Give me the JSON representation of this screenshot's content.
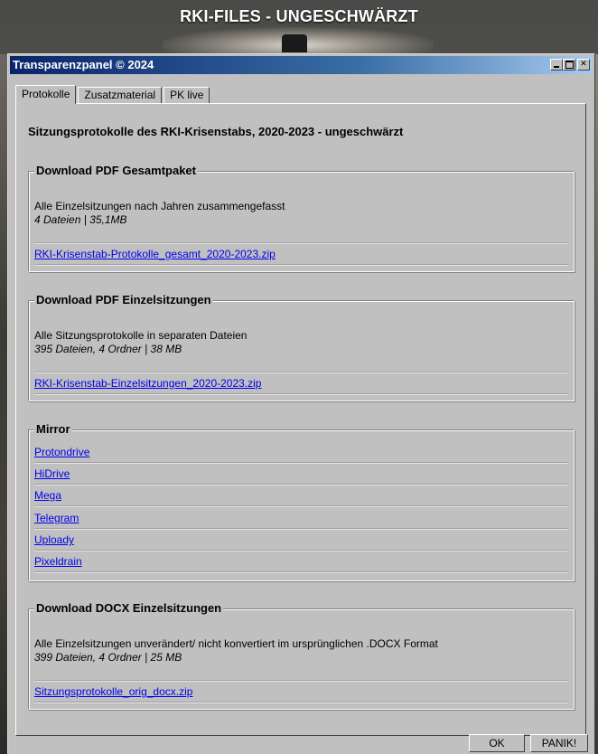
{
  "site": {
    "title": "RKI-FILES - UNGESCHWÄRZT"
  },
  "window": {
    "title": "Transparenzpanel © 2024"
  },
  "tabs": [
    {
      "label": "Protokolle",
      "active": true
    },
    {
      "label": "Zusatzmaterial",
      "active": false
    },
    {
      "label": "PK live",
      "active": false
    }
  ],
  "main": {
    "heading": "Sitzungsprotokolle des RKI-Krisenstabs, 2020-2023 - ungeschwärzt",
    "groups": [
      {
        "title": "Download PDF Gesamtpaket",
        "description": "Alle Einzelsitzungen nach Jahren zusammengefasst",
        "meta": "4 Dateien | 35,1MB",
        "link": "RKI-Krisenstab-Protokolle_gesamt_2020-2023.zip"
      },
      {
        "title": "Download PDF Einzelsitzungen",
        "description": "Alle Sitzungsprotokolle in separaten Dateien",
        "meta": "395 Dateien, 4 Ordner | 38 MB",
        "link": "RKI-Krisenstab-Einzelsitzungen_2020-2023.zip"
      },
      {
        "title": "Mirror",
        "links": [
          "Protondrive",
          "HiDrive",
          "Mega",
          "Telegram",
          "Uploady",
          "Pixeldrain"
        ]
      },
      {
        "title": "Download DOCX Einzelsitzungen",
        "description": "Alle Einzelsitzungen unverändert/ nicht konvertiert im ursprünglichen .DOCX Format",
        "meta": "399 Dateien, 4 Ordner | 25 MB",
        "link": "Sitzungsprotokolle_orig_docx.zip"
      }
    ]
  },
  "buttons": {
    "ok": "OK",
    "panic": "PANIK!"
  },
  "colors": {
    "titlebar_start": "#0a246a",
    "titlebar_end": "#a6caf0",
    "link": "#0000ee",
    "face": "#c0c0c0"
  }
}
